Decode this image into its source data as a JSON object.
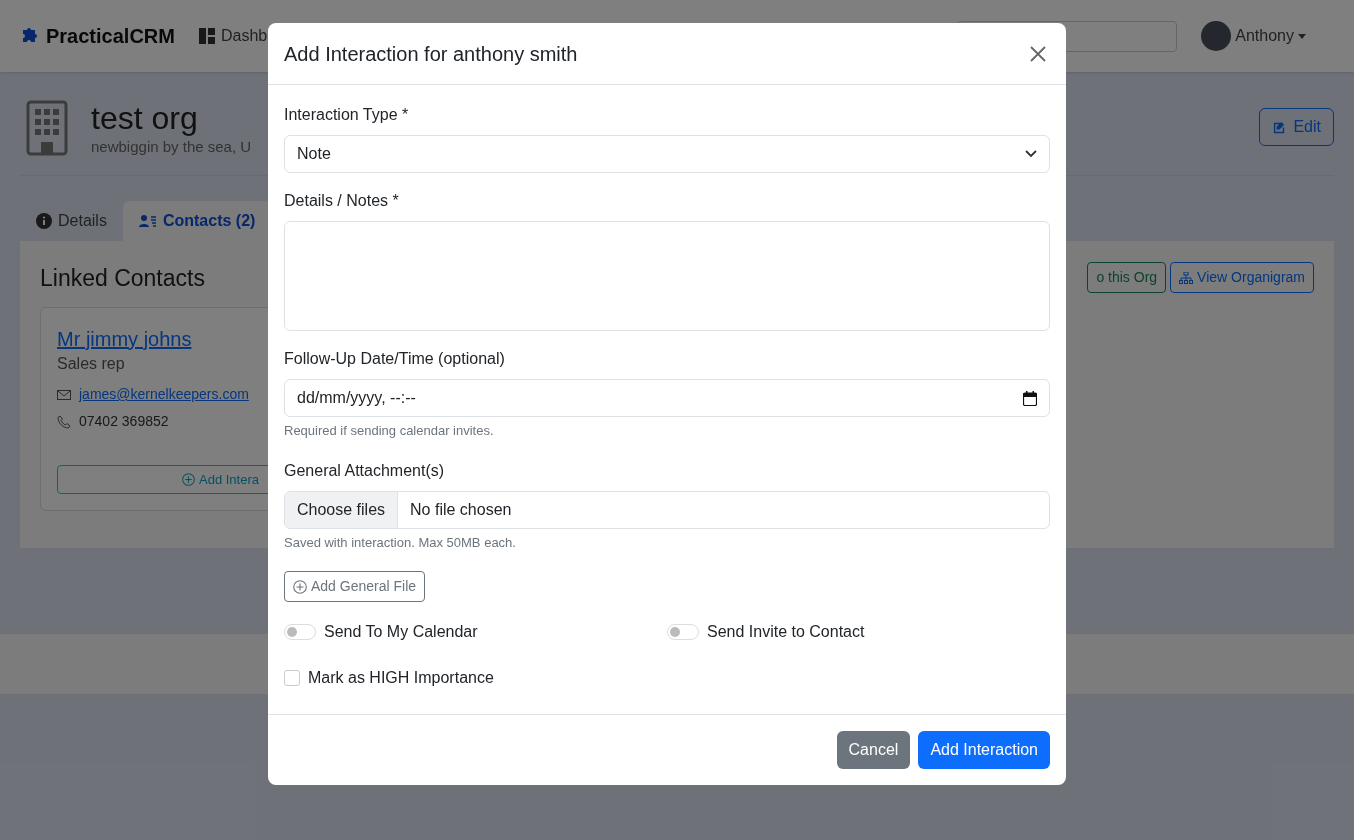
{
  "navbar": {
    "brand": "PracticalCRM",
    "nav_link": "Dashb",
    "user": "Anthony"
  },
  "org": {
    "name": "test org",
    "address": "newbiggin by the sea, U",
    "edit_button": "Edit"
  },
  "tabs": [
    {
      "label": "Details",
      "selected": false,
      "kind": "info"
    },
    {
      "label": "Contacts (2)",
      "selected": true,
      "kind": "contacts"
    }
  ],
  "contacts_panel": {
    "title": "Linked Contacts",
    "buttons": [
      {
        "label": "o this Org",
        "kind": "success"
      },
      {
        "label": "View Organigram",
        "kind": "primary"
      }
    ],
    "contacts": [
      {
        "name": "Mr jimmy johns",
        "role": "Sales rep",
        "email": "james@kernelkeepers.com",
        "phone": "07402 369852",
        "button": "Add Intera"
      }
    ]
  },
  "modal": {
    "title": "Add Interaction for anthony smith",
    "type_field": {
      "label": "Interaction Type *",
      "value": "Note"
    },
    "notes_field": {
      "label": "Details / Notes *"
    },
    "followup_field": {
      "label": "Follow-Up Date/Time (optional)",
      "value": "dd/mm/yyyy, --:--",
      "help": "Required if sending calendar invites."
    },
    "attachment_field": {
      "label": "General Attachment(s)",
      "button": "Choose files",
      "value": "No file chosen",
      "help": "Saved with interaction. Max 50MB each."
    },
    "add_file_button": "Add General File",
    "toggles": [
      {
        "label": "Send To My Calendar",
        "on": false
      },
      {
        "label": "Send Invite to Contact",
        "on": false
      }
    ],
    "checkbox": {
      "label": "Mark as HIGH Importance",
      "checked": false
    },
    "buttons": [
      {
        "label": "Cancel",
        "kind": "secondary"
      },
      {
        "label": "Add Interaction",
        "kind": "primary"
      }
    ]
  }
}
